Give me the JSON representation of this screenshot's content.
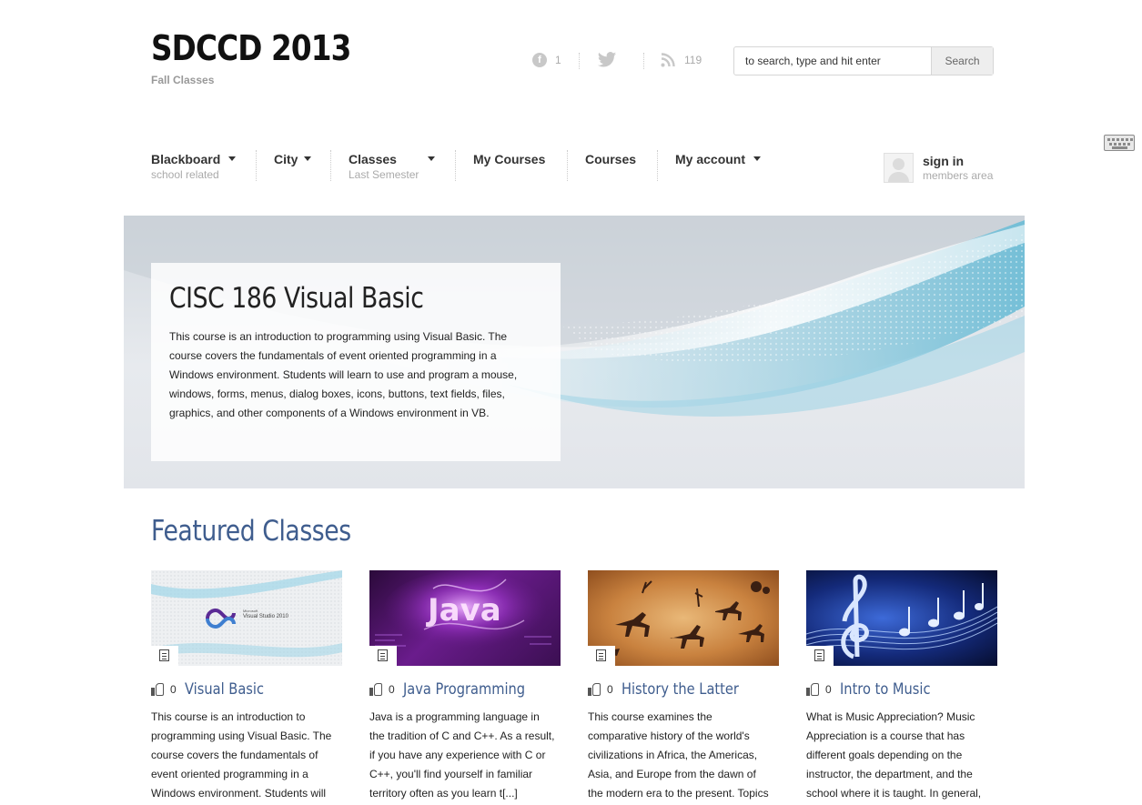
{
  "header": {
    "site_title": "SDCCD 2013",
    "tagline": "Fall Classes",
    "social": {
      "facebook_icon_glyph": "f",
      "facebook_count": "1",
      "rss_count": "119"
    },
    "search": {
      "placeholder": "to search, type and hit enter",
      "button_label": "Search"
    }
  },
  "nav": {
    "items": [
      {
        "label": "Blackboard",
        "sub": "school related",
        "has_dropdown": true
      },
      {
        "label": "City",
        "sub": "",
        "has_dropdown": true
      },
      {
        "label": "Classes",
        "sub": "Last Semester",
        "has_dropdown": true
      },
      {
        "label": "My Courses",
        "sub": "",
        "has_dropdown": false
      },
      {
        "label": "Courses",
        "sub": "",
        "has_dropdown": false
      },
      {
        "label": "My account",
        "sub": "",
        "has_dropdown": true
      }
    ],
    "signin": {
      "label": "sign in",
      "sub": "members area"
    }
  },
  "hero": {
    "title": "CISC 186 Visual Basic",
    "text": "This course is an introduction to programming using Visual Basic. The course covers the fundamentals of event oriented programming in a Windows environment. Students will learn to use and program a mouse, windows, forms, menus, dialog boxes, icons, buttons, text fields, files, graphics, and other components of a Windows environment in VB."
  },
  "featured": {
    "title": "Featured Classes",
    "cards": [
      {
        "title": "Visual Basic",
        "likes": "0",
        "post_format_icon": "image-icon",
        "thumb_caption": "Visual Studio 2010",
        "thumb_caption_small": "Microsoft",
        "text": "This course is an introduction to programming using Visual Basic. The course covers the fundamentals of event oriented programming in a Windows environment. Students will"
      },
      {
        "title": "Java Programming",
        "likes": "0",
        "post_format_icon": "document-icon",
        "thumb_caption": "Java",
        "text": "Java is a programming language in the tradition of C and C++. As a result, if you have any experience with C or C++, you'll find yourself in familiar territory often as you learn t[...]"
      },
      {
        "title": "History the Latter",
        "likes": "0",
        "post_format_icon": "document-icon",
        "text": "This course examines the comparative history of the world's civilizations in Africa, the Americas, Asia, and Europe from the dawn of the modern era to the present. Topics in"
      },
      {
        "title": "Intro to Music",
        "likes": "0",
        "post_format_icon": "document-icon",
        "text": "What is Music Appreciation? Music Appreciation is a course that has different goals depending on the instructor, the department, and the school where it is taught. In general,"
      }
    ]
  },
  "colors": {
    "accent_blue": "#3f5d8e",
    "hero_wave": "#8fcfe2",
    "java_purple": "#6a1c8c",
    "cave_orange": "#b7642a",
    "music_blue": "#142a7a"
  }
}
